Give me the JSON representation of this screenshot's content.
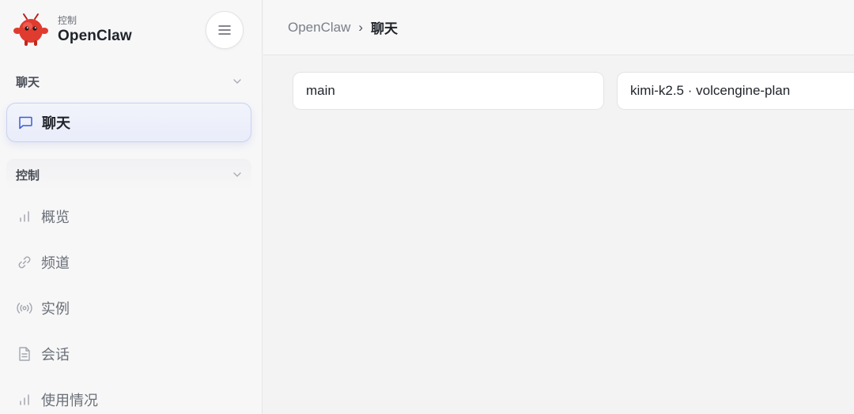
{
  "brand": {
    "subtitle": "控制",
    "title": "OpenClaw"
  },
  "sidebar": {
    "sections": [
      {
        "label": "聊天",
        "items": [
          {
            "label": "聊天",
            "icon": "chat-bubble-icon",
            "active": true
          }
        ]
      },
      {
        "label": "控制",
        "items": [
          {
            "label": "概览",
            "icon": "bar-chart-icon"
          },
          {
            "label": "频道",
            "icon": "link-icon"
          },
          {
            "label": "实例",
            "icon": "broadcast-icon"
          },
          {
            "label": "会话",
            "icon": "document-icon"
          },
          {
            "label": "使用情况",
            "icon": "bar-chart-icon"
          }
        ]
      }
    ]
  },
  "breadcrumb": {
    "root": "OpenClaw",
    "separator": "›",
    "current": "聊天"
  },
  "main": {
    "session_value": "main",
    "model_value": "kimi-k2.5 · volcengine-plan"
  },
  "colors": {
    "accent": "#3b5bdb",
    "active_border": "#c9d1f1",
    "logo_red": "#d92d20"
  }
}
